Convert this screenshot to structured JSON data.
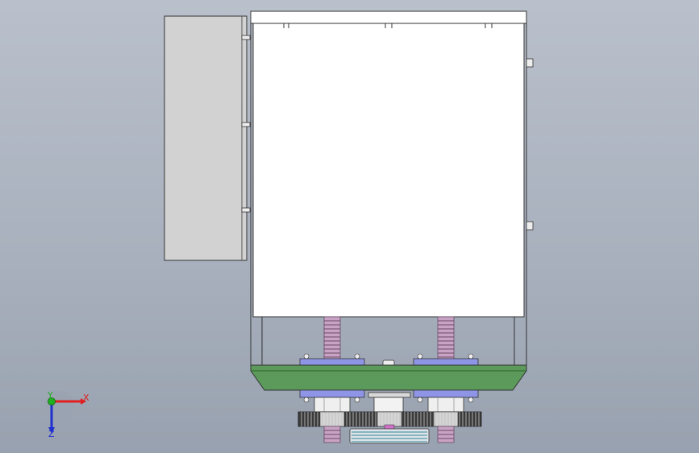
{
  "viewport": {
    "background_top": "#b9c0cb",
    "background_bottom": "#98a1af"
  },
  "model": {
    "panel_color": "#d2d2d2",
    "cabinet_color": "#ffffff",
    "outline_color": "#333333",
    "base_plate_color": "#5b9a5b",
    "bracket_color": "#8f95e6",
    "spring_color": "#c9a3c4",
    "gear_color": "#3a3a3a"
  },
  "triad": {
    "x_label": "X",
    "y_label": "Y",
    "z_label": "Z",
    "x_color": "#e02020",
    "y_color": "#20b020",
    "z_color": "#2030d0"
  }
}
